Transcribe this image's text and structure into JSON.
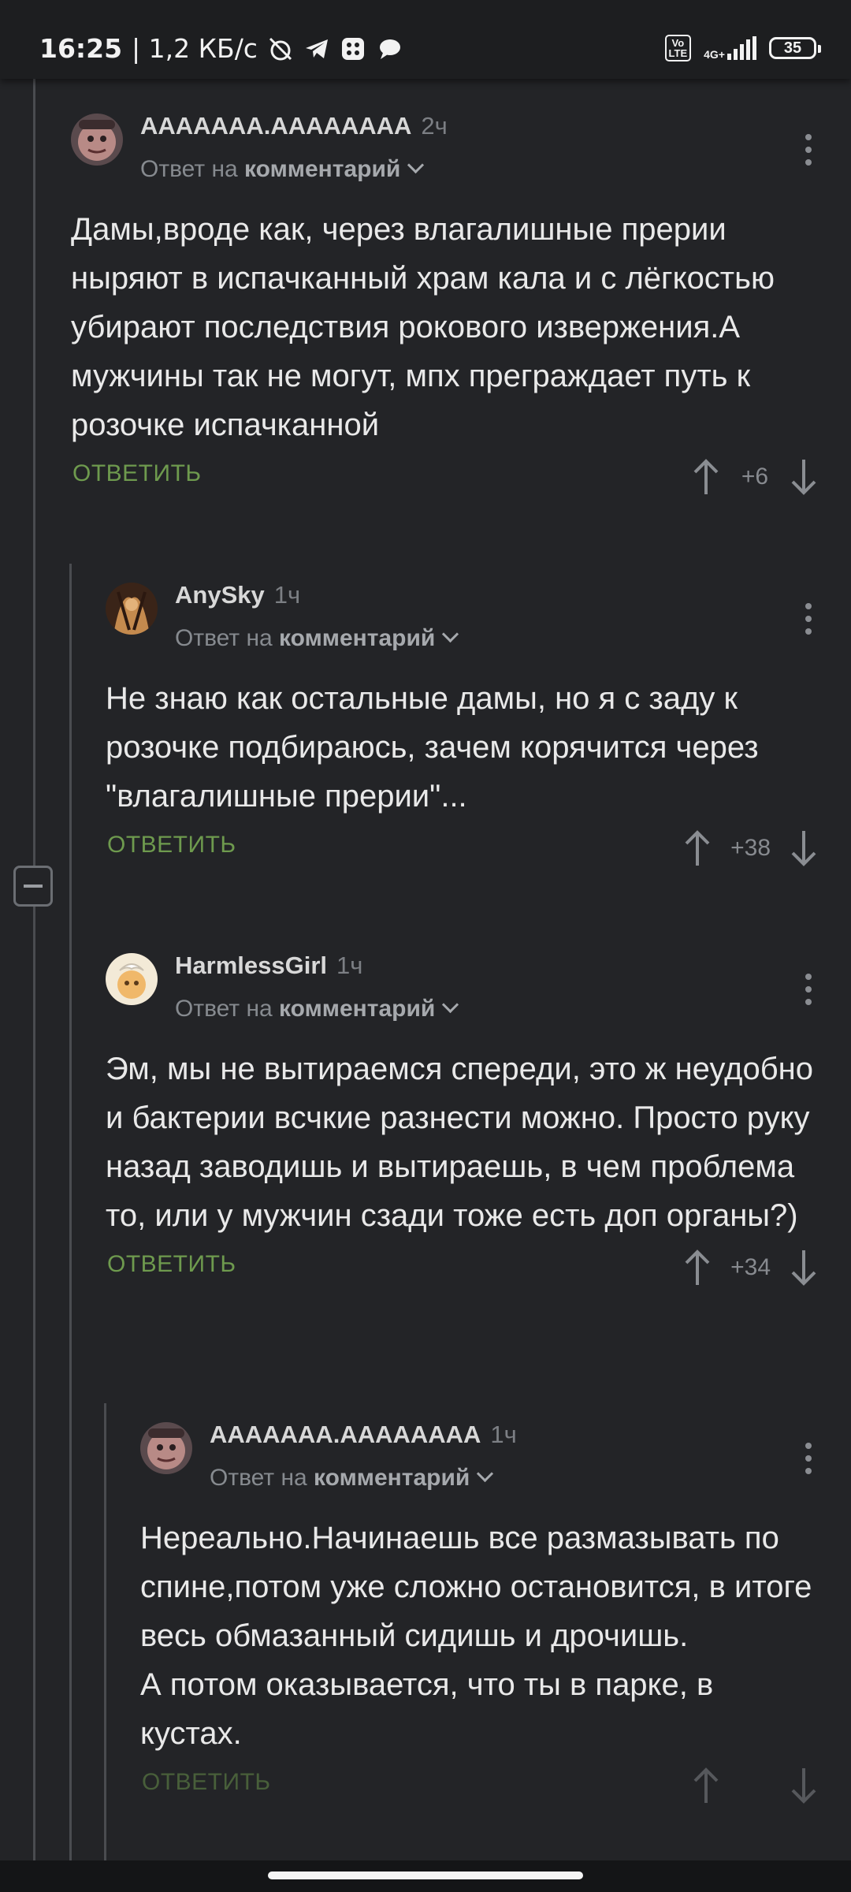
{
  "status": {
    "time": "16:25",
    "speed": "| 1,2 КБ/с",
    "lte": "Vo\nLTE",
    "network": "4G+",
    "battery": "35"
  },
  "ui": {
    "reply_prefix": "Ответ на",
    "reply_link": "комментарий",
    "reply_action": "ОТВЕТИТЬ"
  },
  "comments": [
    {
      "author": "AAAAAAA.AAAAAAAA",
      "time": "2ч",
      "text": "Дамы,вроде как, через влагалишные прерии ныряют в испачканный храм кала и с лёгкостью убирают последствия рокового извержения.А мужчины так не могут, мпх преграждает путь к розочке испачканной",
      "score": "+6"
    },
    {
      "author": "AnySky",
      "time": "1ч",
      "text": "Не знаю как остальные дамы, но я с заду к розочке подбираюсь, зачем корячится через \"влагалишные прерии\"...",
      "score": "+38"
    },
    {
      "author": "HarmlessGirl",
      "time": "1ч",
      "text": "Эм, мы не вытираемся спереди, это ж неудобно и бактерии всчкие разнести можно. Просто руку назад заводишь и вытираешь, в чем проблема то, или у мужчин сзади тоже есть доп органы?)",
      "score": "+34"
    },
    {
      "author": "AAAAAAA.AAAAAAAA",
      "time": "1ч",
      "text": "Нереально.Начинаешь все размазывать по спине,потом уже сложно остановится, в итоге весь обмазанный сидишь и дрочишь.\nА потом оказывается, что ты в парке, в кустах.",
      "score": ""
    }
  ],
  "colors": {
    "background": "#232427",
    "reply_action": "#6e9a4e",
    "text": "#e9e9e9"
  }
}
